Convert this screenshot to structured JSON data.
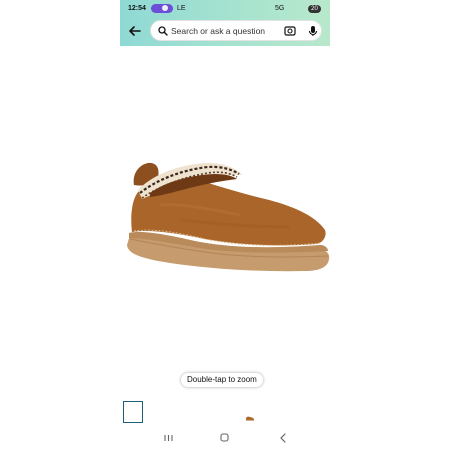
{
  "status_bar": {
    "time": "12:54",
    "carrier": "LE",
    "network": "5G",
    "battery": "20"
  },
  "search": {
    "placeholder": "Search or ask a question"
  },
  "product": {
    "zoom_hint": "Double-tap to zoom"
  },
  "colors": {
    "header_gradient_start": "#8fd9d5",
    "header_gradient_end": "#b8e8cc",
    "shoe_suede": "#a9652a",
    "sole": "#c69b6d",
    "thumb_border": "#1b5f72"
  },
  "icons": [
    "back-arrow-icon",
    "search-icon",
    "camera-icon",
    "mic-icon",
    "recent-apps-icon",
    "home-icon",
    "nav-back-icon"
  ]
}
